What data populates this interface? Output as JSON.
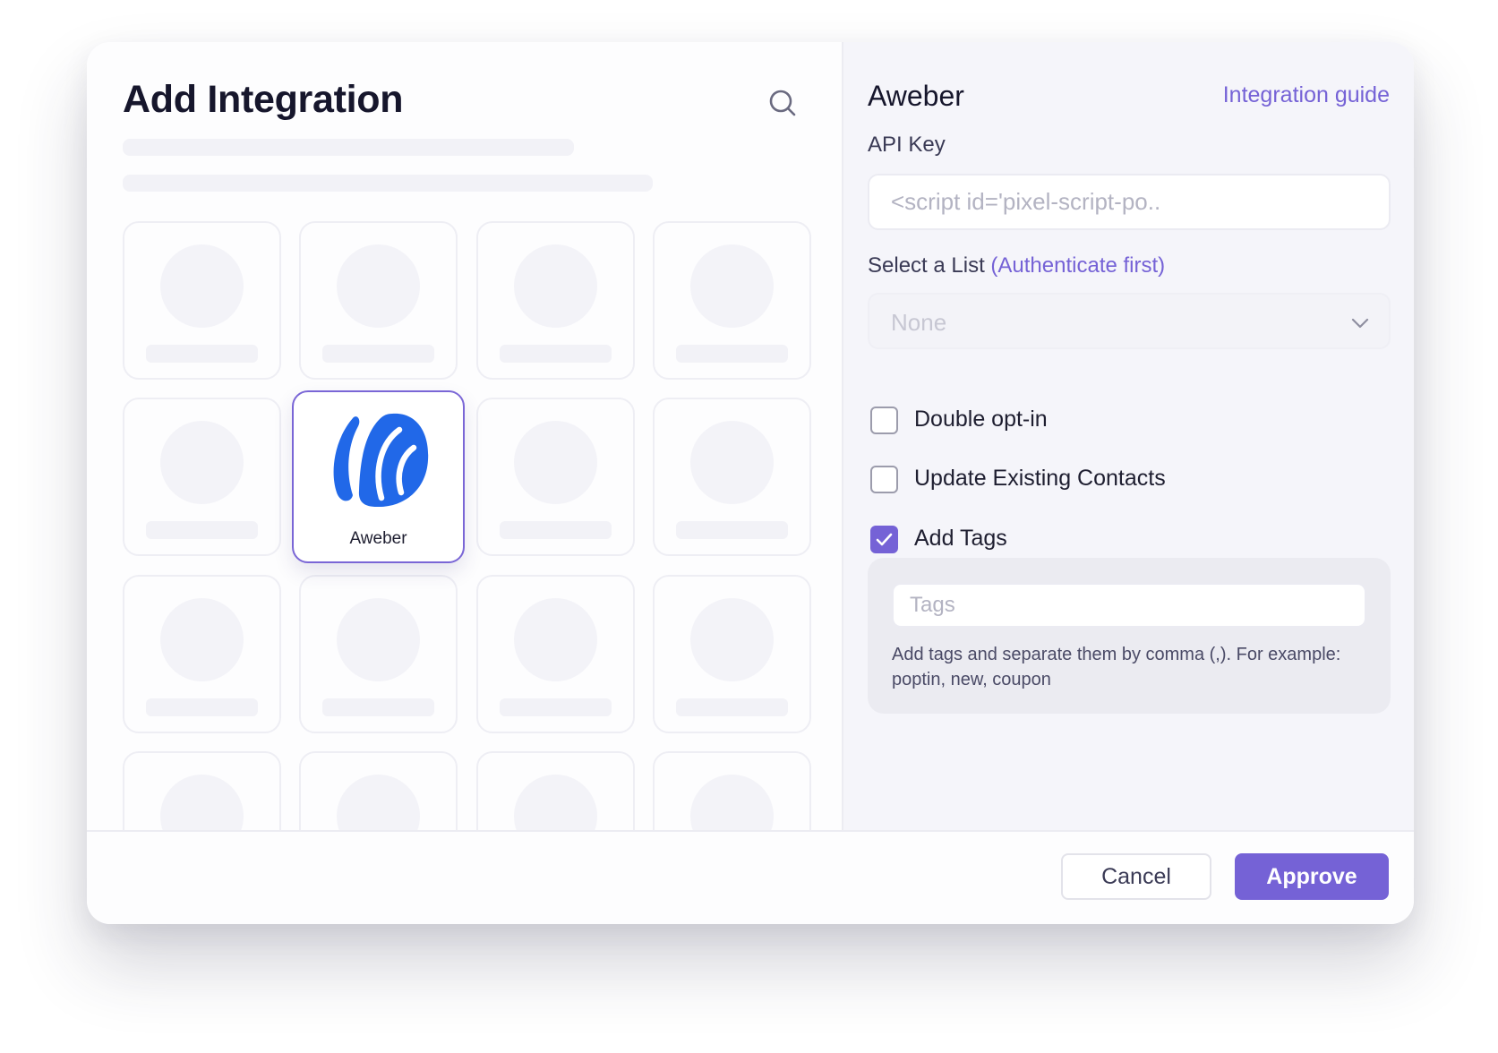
{
  "modal": {
    "title": "Add Integration",
    "icons": {
      "search": "search-icon",
      "selected_logo": "aweber-logo-icon",
      "chevron": "chevron-down-icon",
      "check": "check-icon"
    },
    "selected_tile": {
      "label": "Aweber"
    }
  },
  "settings": {
    "provider_name": "Aweber",
    "guide_link": "Integration guide",
    "api_key": {
      "label": "API Key",
      "placeholder": "<script id='pixel-script-po..",
      "value": ""
    },
    "list_select": {
      "label": "Select a List",
      "hint": "(Authenticate first)",
      "selected_value": "None"
    },
    "options": [
      {
        "label": "Double opt-in",
        "checked": false
      },
      {
        "label": "Update Existing Contacts",
        "checked": false
      },
      {
        "label": "Add Tags",
        "checked": true
      }
    ],
    "tags": {
      "placeholder": "Tags",
      "value": "",
      "help_text": "Add tags and separate them by comma (,). For example: poptin, new, coupon"
    }
  },
  "footer": {
    "cancel_label": "Cancel",
    "approve_label": "Approve"
  },
  "colors": {
    "accent": "#7562d6",
    "aweber_blue": "#2168e8",
    "title_text": "#16162c"
  }
}
